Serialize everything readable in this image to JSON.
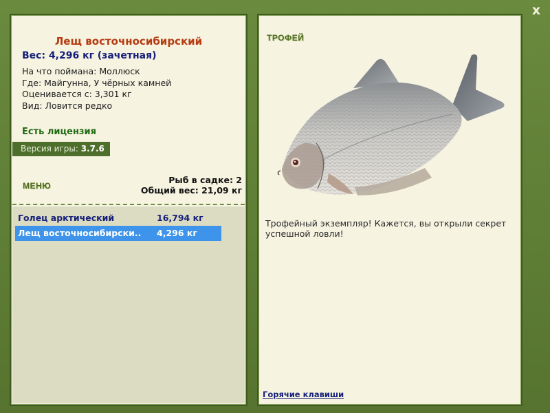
{
  "window": {
    "close_label": "x"
  },
  "fish": {
    "title": "Лещ восточносибирский",
    "weight_line": "Вес: 4,296 кг (зачетная)",
    "bait": "На что поймана: Моллюск",
    "place": "Где: Майгунна, У чёрных камней",
    "rated_from": "Оценивается с: 3,301 кг",
    "kind": "Вид: Ловится редко"
  },
  "license_text": "Есть лицензия",
  "version": {
    "label": "Версия игры:",
    "value": "3.7.6"
  },
  "menu_label": "МЕНЮ",
  "keepnet": {
    "count": "Рыб в садке: 2",
    "total": "Общий вес: 21,09 кг"
  },
  "catch_list": [
    {
      "name": "Голец арктический",
      "weight": "16,794 кг",
      "selected": false
    },
    {
      "name": "Лещ восточносибирски...",
      "weight": "4,296 кг",
      "selected": true
    }
  ],
  "trophy": {
    "label": "ТРОФЕЙ",
    "description": "Трофейный экземпляр! Кажется, вы открыли секрет успешной ловли!"
  },
  "hotkeys_label": "Горячие клавиши",
  "colors": {
    "frame": "#5c7a34",
    "panel": "#f6f3e1",
    "title": "#b63b10",
    "accent_blue": "#16207a",
    "selection": "#3d94ea",
    "license_green": "#1e6b12"
  },
  "icons": {
    "close": "close-icon",
    "fish": "bream-fish-image"
  }
}
